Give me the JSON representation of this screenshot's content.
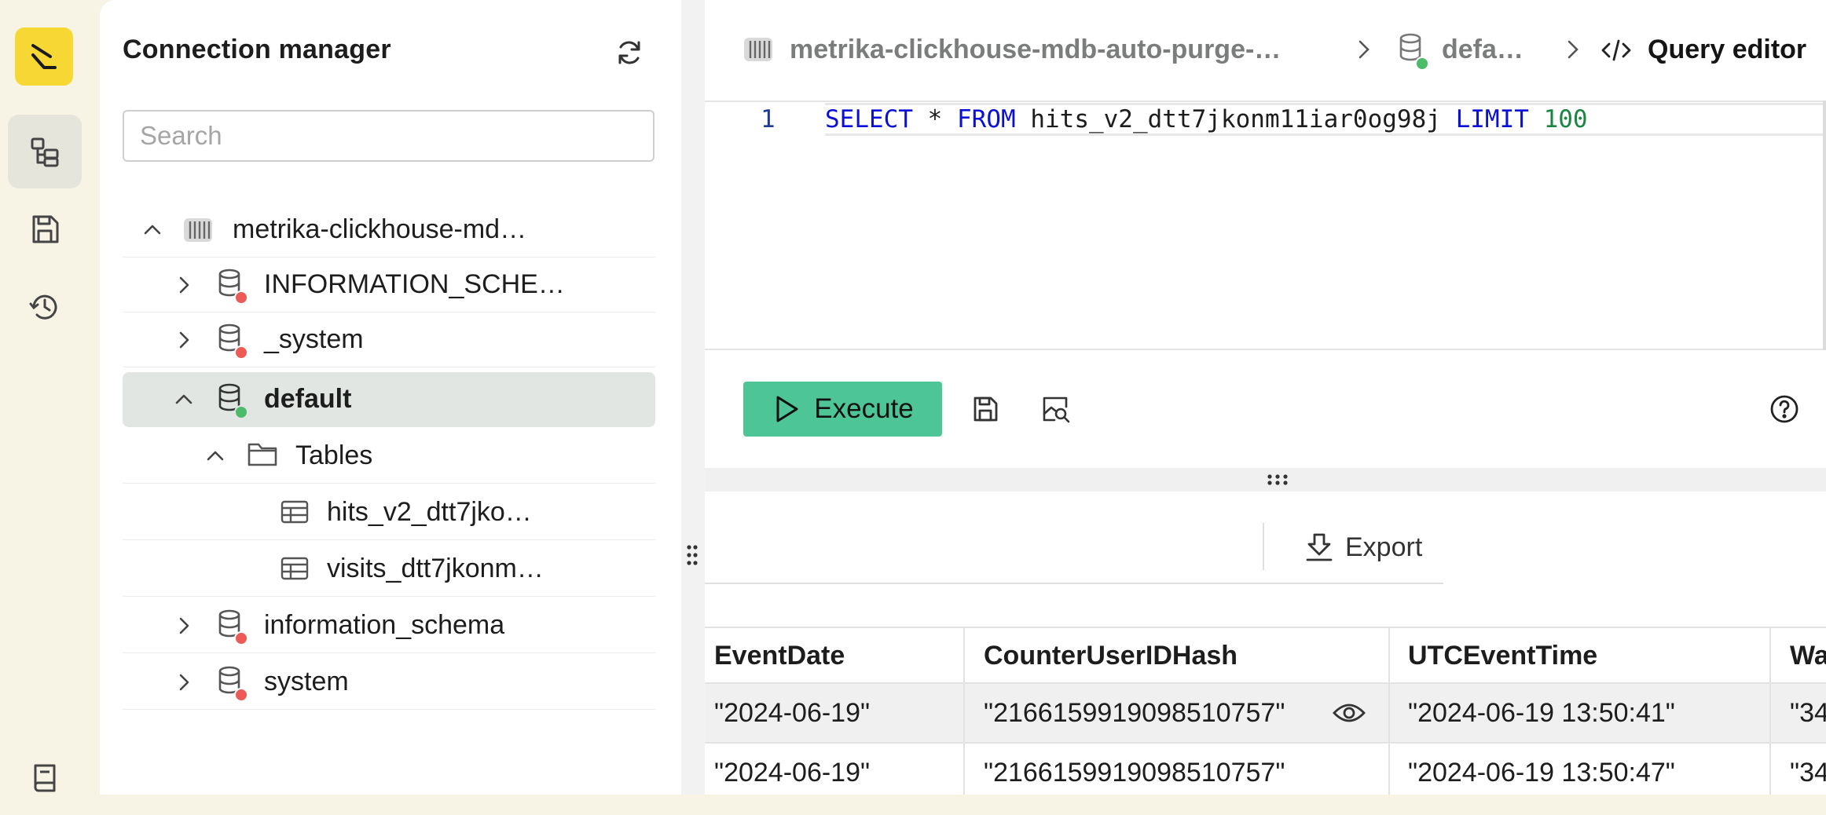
{
  "rail": {
    "items": [
      {
        "name": "connection-tree",
        "active": true
      },
      {
        "name": "saved-queries",
        "active": false
      },
      {
        "name": "history",
        "active": false
      },
      {
        "name": "docs",
        "active": false
      }
    ]
  },
  "sidebar": {
    "title": "Connection manager",
    "search_placeholder": "Search",
    "tree": [
      {
        "label": "metrika-clickhouse-md…",
        "type": "cluster",
        "expanded": true
      },
      {
        "label": "INFORMATION_SCHE…",
        "type": "database",
        "status": "red",
        "expanded": false
      },
      {
        "label": "_system",
        "type": "database",
        "status": "red",
        "expanded": false
      },
      {
        "label": "default",
        "type": "database",
        "status": "green",
        "expanded": true,
        "selected": true
      },
      {
        "label": "Tables",
        "type": "folder",
        "expanded": true
      },
      {
        "label": "hits_v2_dtt7jko…",
        "type": "table"
      },
      {
        "label": "visits_dtt7jkonm…",
        "type": "table"
      },
      {
        "label": "information_schema",
        "type": "database",
        "status": "red",
        "expanded": false
      },
      {
        "label": "system",
        "type": "database",
        "status": "red",
        "expanded": false
      }
    ]
  },
  "breadcrumb": {
    "cluster": "metrika-clickhouse-mdb-auto-purge-…",
    "database": "defa…",
    "page": "Query editor"
  },
  "editor": {
    "line_number": "1",
    "tokens": {
      "select": "SELECT",
      "star": "*",
      "from": "FROM",
      "table": "hits_v2_dtt7jkonm11iar0og98j",
      "limit": "LIMIT",
      "limit_value": "100"
    }
  },
  "actions": {
    "execute_label": "Execute"
  },
  "results": {
    "export_label": "Export",
    "columns": [
      "EventDate",
      "CounterUserIDHash",
      "UTCEventTime",
      "Wa"
    ],
    "rows": [
      [
        "\"2024-06-19\"",
        "\"2166159919098510757\"",
        "\"2024-06-19 13:50:41\"",
        "\"34"
      ],
      [
        "\"2024-06-19\"",
        "\"2166159919098510757\"",
        "\"2024-06-19 13:50:47\"",
        "\"34"
      ]
    ]
  },
  "colors": {
    "accent_yellow": "#f6d733",
    "execute_green": "#4ec596",
    "status_red": "#ec5b55",
    "status_green": "#4cbb6a",
    "keyword_blue": "#0a10d8",
    "number_green": "#1b8640"
  }
}
